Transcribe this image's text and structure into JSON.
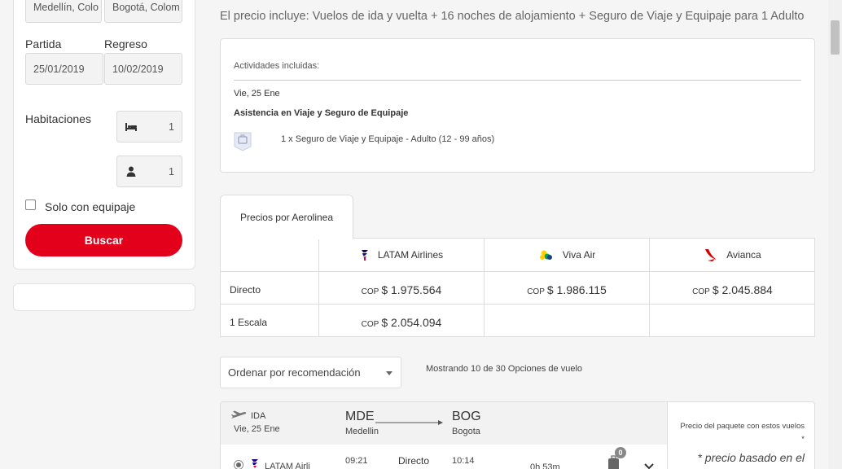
{
  "search": {
    "origin_value": "Medellín, Colo",
    "destination_value": "Bogotá, Colom",
    "departure_label": "Partida",
    "return_label": "Regreso",
    "departure_value": "25/01/2019",
    "return_value": "10/02/2019",
    "rooms_label": "Habitaciones",
    "rooms_value": "1",
    "adults_value": "1",
    "luggage_label": "Solo con equipaje",
    "search_button": "Buscar"
  },
  "package": {
    "includes_text": "El precio incluye: Vuelos de ida y vuelta + 16 noches de alojamiento + Seguro de Viaje y Equipaje para 1 Adulto"
  },
  "activities": {
    "header": "Actividades incluidas:",
    "date": "Vie, 25 Ene",
    "title": "Asistencia en Viaje y Seguro de Equipaje",
    "item": "1 x Seguro de Viaje y Equipaje - Adulto (12 - 99 años)"
  },
  "airline_prices": {
    "tab_label": "Precios por Aerolinea",
    "airlines": [
      {
        "name": "LATAM Airlines",
        "icon": "latam-logo"
      },
      {
        "name": "Viva Air",
        "icon": "viva-air-logo"
      },
      {
        "name": "Avianca",
        "icon": "avianca-logo"
      }
    ],
    "rows": [
      {
        "label": "Directo",
        "prices": [
          {
            "cur": "COP",
            "amt": "$ 1.975.564"
          },
          {
            "cur": "COP",
            "amt": "$ 1.986.115"
          },
          {
            "cur": "COP",
            "amt": "$ 2.045.884"
          }
        ]
      },
      {
        "label": "1 Escala",
        "prices": [
          {
            "cur": "COP",
            "amt": "$ 2.054.094"
          },
          {
            "cur": "",
            "amt": ""
          },
          {
            "cur": "",
            "amt": ""
          }
        ]
      }
    ]
  },
  "sort": {
    "selected": "Ordenar por recomendación",
    "showing": "Mostrando 10 de 30 Opciones de vuelo"
  },
  "flight": {
    "direction": "IDA",
    "date": "Vie, 25 Ene",
    "from_code": "MDE",
    "from_city": "Medellin",
    "to_code": "BOG",
    "to_city": "Bogota",
    "airline": "LATAM Airli",
    "dep_time": "09:21",
    "stops": "Directo",
    "arr_time": "10:14",
    "duration": "0h 53m",
    "bag_count": "0",
    "price_note": "Precio del paquete con estos vuelos *",
    "price_basis": "* precio basado en el"
  },
  "colors": {
    "accent": "#e2001a",
    "latam": "#1b0088",
    "avianca": "#d50000",
    "viva": "#ffd200"
  }
}
